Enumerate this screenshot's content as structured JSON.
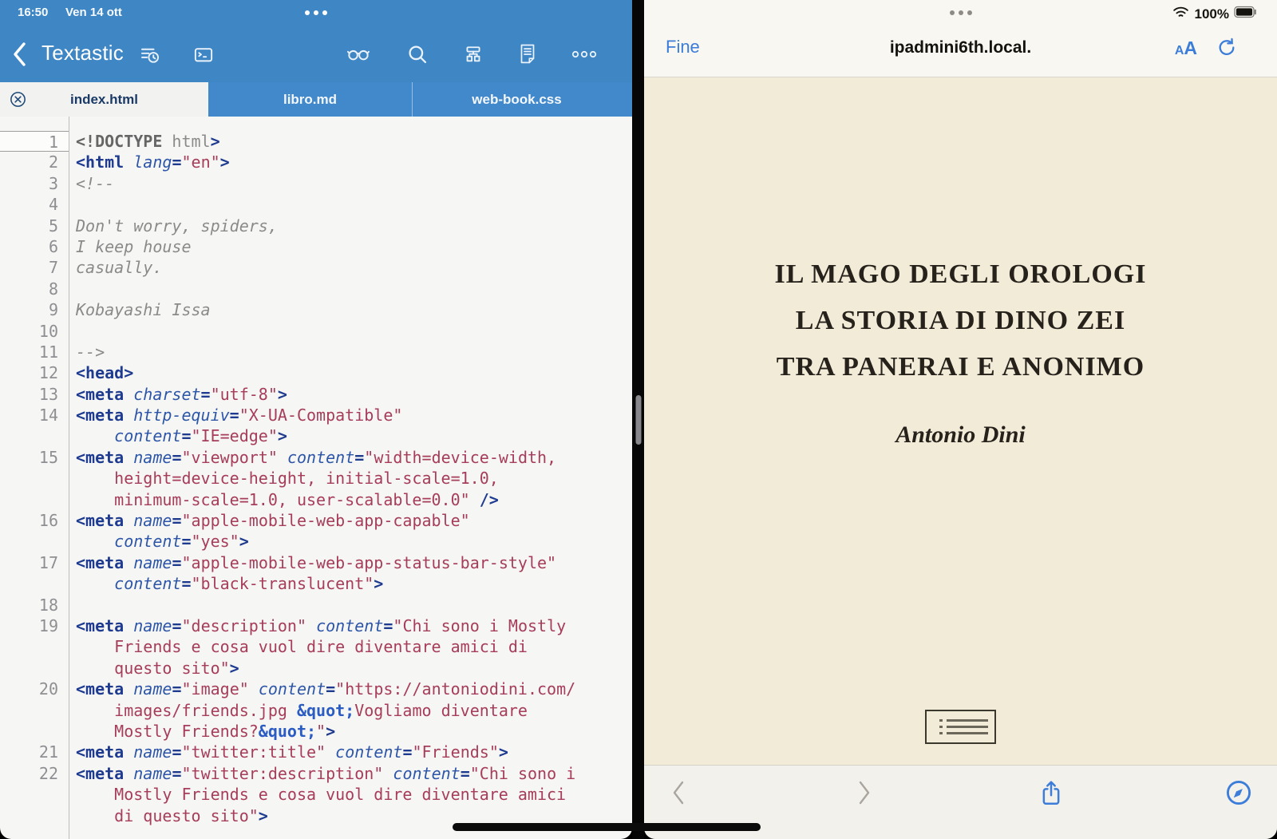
{
  "colors": {
    "textastic_blue": "#3f86c5",
    "tabbar_blue": "#4289cb",
    "safari_tint_blue": "#3b7dd8",
    "page_cream": "#f2ebd8",
    "editor_bg": "#f6f6f4",
    "syntax_tag": "#1e3b90",
    "syntax_attr": "#2d56a8",
    "syntax_string": "#a63d5a",
    "syntax_comment": "#8a8a8a",
    "syntax_entity": "#2b5cc4"
  },
  "status_bar": {
    "time": "16:50",
    "date": "Ven 14 ott",
    "battery_percent": "100%"
  },
  "textastic": {
    "app_title": "Textastic",
    "toolbar_icon_names": [
      "back-chevron",
      "recent-files",
      "snippets-keyboard",
      "preview-glasses",
      "search",
      "symbol-navigator",
      "file-info",
      "more-ellipsis"
    ],
    "tabs": [
      {
        "label": "index.html",
        "active": true
      },
      {
        "label": "libro.md",
        "active": false
      },
      {
        "label": "web-book.css",
        "active": false
      }
    ],
    "code_rows": [
      {
        "n": "1",
        "cur": true,
        "s": [
          [
            "d",
            "<!DOCTYPE"
          ],
          [
            "p",
            " html"
          ],
          [
            "g",
            ">"
          ]
        ]
      },
      {
        "n": "2",
        "s": [
          [
            "g",
            "<html"
          ],
          [
            "a",
            " lang"
          ],
          [
            "g",
            "="
          ],
          [
            "s",
            "\"en\""
          ],
          [
            "g",
            ">"
          ]
        ]
      },
      {
        "n": "3",
        "s": [
          [
            "c",
            "<!--"
          ]
        ]
      },
      {
        "n": "4",
        "s": []
      },
      {
        "n": "5",
        "s": [
          [
            "c",
            "Don't worry, spiders,"
          ]
        ]
      },
      {
        "n": "6",
        "s": [
          [
            "c",
            "I keep house"
          ]
        ]
      },
      {
        "n": "7",
        "s": [
          [
            "c",
            "casually."
          ]
        ]
      },
      {
        "n": "8",
        "s": []
      },
      {
        "n": "9",
        "s": [
          [
            "c",
            "Kobayashi Issa"
          ]
        ]
      },
      {
        "n": "10",
        "s": []
      },
      {
        "n": "11",
        "s": [
          [
            "c",
            "-->"
          ]
        ]
      },
      {
        "n": "12",
        "s": [
          [
            "g",
            "<head>"
          ]
        ]
      },
      {
        "n": "13",
        "s": [
          [
            "g",
            "<meta"
          ],
          [
            "a",
            " charset"
          ],
          [
            "g",
            "="
          ],
          [
            "s",
            "\"utf-8\""
          ],
          [
            "g",
            ">"
          ]
        ]
      },
      {
        "n": "14",
        "s": [
          [
            "g",
            "<meta"
          ],
          [
            "a",
            " http-equiv"
          ],
          [
            "g",
            "="
          ],
          [
            "s",
            "\"X-UA-Compatible\""
          ]
        ]
      },
      {
        "n": "",
        "s": [
          [
            "a",
            "    content"
          ],
          [
            "g",
            "="
          ],
          [
            "s",
            "\"IE=edge\""
          ],
          [
            "g",
            ">"
          ]
        ]
      },
      {
        "n": "15",
        "s": [
          [
            "g",
            "<meta"
          ],
          [
            "a",
            " name"
          ],
          [
            "g",
            "="
          ],
          [
            "s",
            "\"viewport\""
          ],
          [
            "a",
            " content"
          ],
          [
            "g",
            "="
          ],
          [
            "s",
            "\"width=device-width,"
          ]
        ]
      },
      {
        "n": "",
        "s": [
          [
            "s",
            "    height=device-height, initial-scale=1.0,"
          ]
        ]
      },
      {
        "n": "",
        "s": [
          [
            "s",
            "    minimum-scale=1.0, user-scalable=0.0\""
          ],
          [
            "g",
            " />"
          ]
        ]
      },
      {
        "n": "16",
        "s": [
          [
            "g",
            "<meta"
          ],
          [
            "a",
            " name"
          ],
          [
            "g",
            "="
          ],
          [
            "s",
            "\"apple-mobile-web-app-capable\""
          ]
        ]
      },
      {
        "n": "",
        "s": [
          [
            "a",
            "    content"
          ],
          [
            "g",
            "="
          ],
          [
            "s",
            "\"yes\""
          ],
          [
            "g",
            ">"
          ]
        ]
      },
      {
        "n": "17",
        "s": [
          [
            "g",
            "<meta"
          ],
          [
            "a",
            " name"
          ],
          [
            "g",
            "="
          ],
          [
            "s",
            "\"apple-mobile-web-app-status-bar-style\""
          ]
        ]
      },
      {
        "n": "",
        "s": [
          [
            "a",
            "    content"
          ],
          [
            "g",
            "="
          ],
          [
            "s",
            "\"black-translucent\""
          ],
          [
            "g",
            ">"
          ]
        ]
      },
      {
        "n": "18",
        "s": []
      },
      {
        "n": "19",
        "s": [
          [
            "g",
            "<meta"
          ],
          [
            "a",
            " name"
          ],
          [
            "g",
            "="
          ],
          [
            "s",
            "\"description\""
          ],
          [
            "a",
            " content"
          ],
          [
            "g",
            "="
          ],
          [
            "s",
            "\"Chi sono i Mostly"
          ]
        ]
      },
      {
        "n": "",
        "s": [
          [
            "s",
            "    Friends e cosa vuol dire diventare amici di"
          ]
        ]
      },
      {
        "n": "",
        "s": [
          [
            "s",
            "    questo sito\""
          ],
          [
            "g",
            ">"
          ]
        ]
      },
      {
        "n": "20",
        "s": [
          [
            "g",
            "<meta"
          ],
          [
            "a",
            " name"
          ],
          [
            "g",
            "="
          ],
          [
            "s",
            "\"image\""
          ],
          [
            "a",
            " content"
          ],
          [
            "g",
            "="
          ],
          [
            "s",
            "\"https://antoniodini.com/"
          ]
        ]
      },
      {
        "n": "",
        "s": [
          [
            "s",
            "    images/friends.jpg "
          ],
          [
            "e",
            "&quot;"
          ],
          [
            "s",
            "Vogliamo diventare"
          ]
        ]
      },
      {
        "n": "",
        "s": [
          [
            "s",
            "    Mostly Friends?"
          ],
          [
            "e",
            "&quot;"
          ],
          [
            "s",
            "\""
          ],
          [
            "g",
            ">"
          ]
        ]
      },
      {
        "n": "21",
        "s": [
          [
            "g",
            "<meta"
          ],
          [
            "a",
            " name"
          ],
          [
            "g",
            "="
          ],
          [
            "s",
            "\"twitter:title\""
          ],
          [
            "a",
            " content"
          ],
          [
            "g",
            "="
          ],
          [
            "s",
            "\"Friends\""
          ],
          [
            "g",
            ">"
          ]
        ]
      },
      {
        "n": "22",
        "s": [
          [
            "g",
            "<meta"
          ],
          [
            "a",
            " name"
          ],
          [
            "g",
            "="
          ],
          [
            "s",
            "\"twitter:description\""
          ],
          [
            "a",
            " content"
          ],
          [
            "g",
            "="
          ],
          [
            "s",
            "\"Chi sono i"
          ]
        ]
      },
      {
        "n": "",
        "s": [
          [
            "s",
            "    Mostly Friends e cosa vuol dire diventare amici"
          ]
        ]
      },
      {
        "n": "",
        "s": [
          [
            "s",
            "    di questo sito\""
          ],
          [
            "g",
            ">"
          ]
        ]
      }
    ]
  },
  "safari": {
    "done_label": "Fine",
    "url_title": "ipadmini6th.local.",
    "font_size_button": {
      "small_a": "A",
      "large_a": "A"
    },
    "toolbar_icon_names": [
      "back-chevron",
      "forward-chevron",
      "share",
      "safari-compass"
    ],
    "page": {
      "title_lines": [
        "IL MAGO DEGLI OROLOGI",
        "LA STORIA DI DINO ZEI",
        "TRA PANERAI E ANONIMO"
      ],
      "author": "Antonio Dini",
      "placeholder_icon": "list-image-placeholder"
    }
  }
}
